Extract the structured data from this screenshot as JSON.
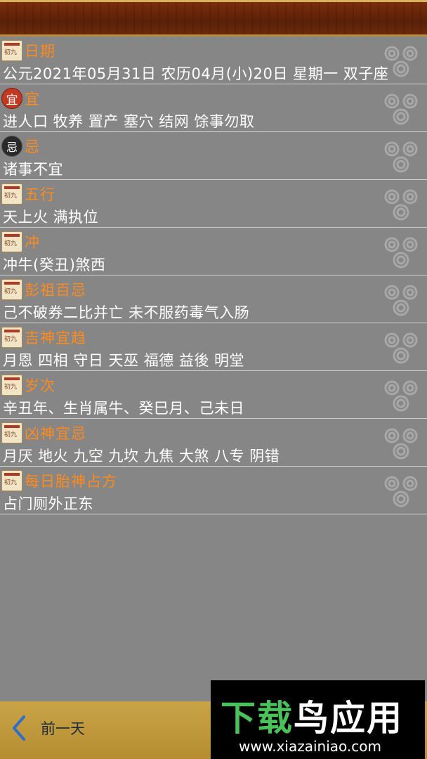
{
  "rows": [
    {
      "icon": "book",
      "title": "日期",
      "value": "公元2021年05月31日 农历04月(小)20日   星期一   双子座"
    },
    {
      "icon": "yi",
      "title": "宜",
      "value": "进人口 牧养 置产 塞穴 结网 馀事勿取"
    },
    {
      "icon": "ji",
      "title": "忌",
      "value": "诸事不宜"
    },
    {
      "icon": "book",
      "title": "五行",
      "value": "天上火 满执位"
    },
    {
      "icon": "book",
      "title": "冲",
      "value": "冲牛(癸丑)煞西"
    },
    {
      "icon": "book",
      "title": "彭祖百忌",
      "value": "己不破券二比并亡 未不服药毒气入肠"
    },
    {
      "icon": "book",
      "title": "吉神宜趋",
      "value": "月恩 四相 守日 天巫 福德 益後 明堂"
    },
    {
      "icon": "book",
      "title": "岁次",
      "value": "辛丑年、生肖属牛、癸巳月、己未日"
    },
    {
      "icon": "book",
      "title": "凶神宜忌",
      "value": "月厌 地火 九空 九坎 九焦 大煞 八专 阴错"
    },
    {
      "icon": "book",
      "title": "每日胎神占方",
      "value": "占门厕外正东"
    }
  ],
  "icons": {
    "yi_glyph": "宜",
    "ji_glyph": "忌"
  },
  "footer": {
    "prev_label": "前一天"
  },
  "watermark": {
    "brand": "下载鸟应用",
    "brand_green": "下载",
    "brand_white": "鸟应用",
    "url": "www.xiazainiao.com"
  },
  "colors": {
    "title": "#ff8a1c",
    "value": "#ffffff",
    "background": "#868686",
    "header": "#5a2008",
    "footer": "#c9a447"
  }
}
